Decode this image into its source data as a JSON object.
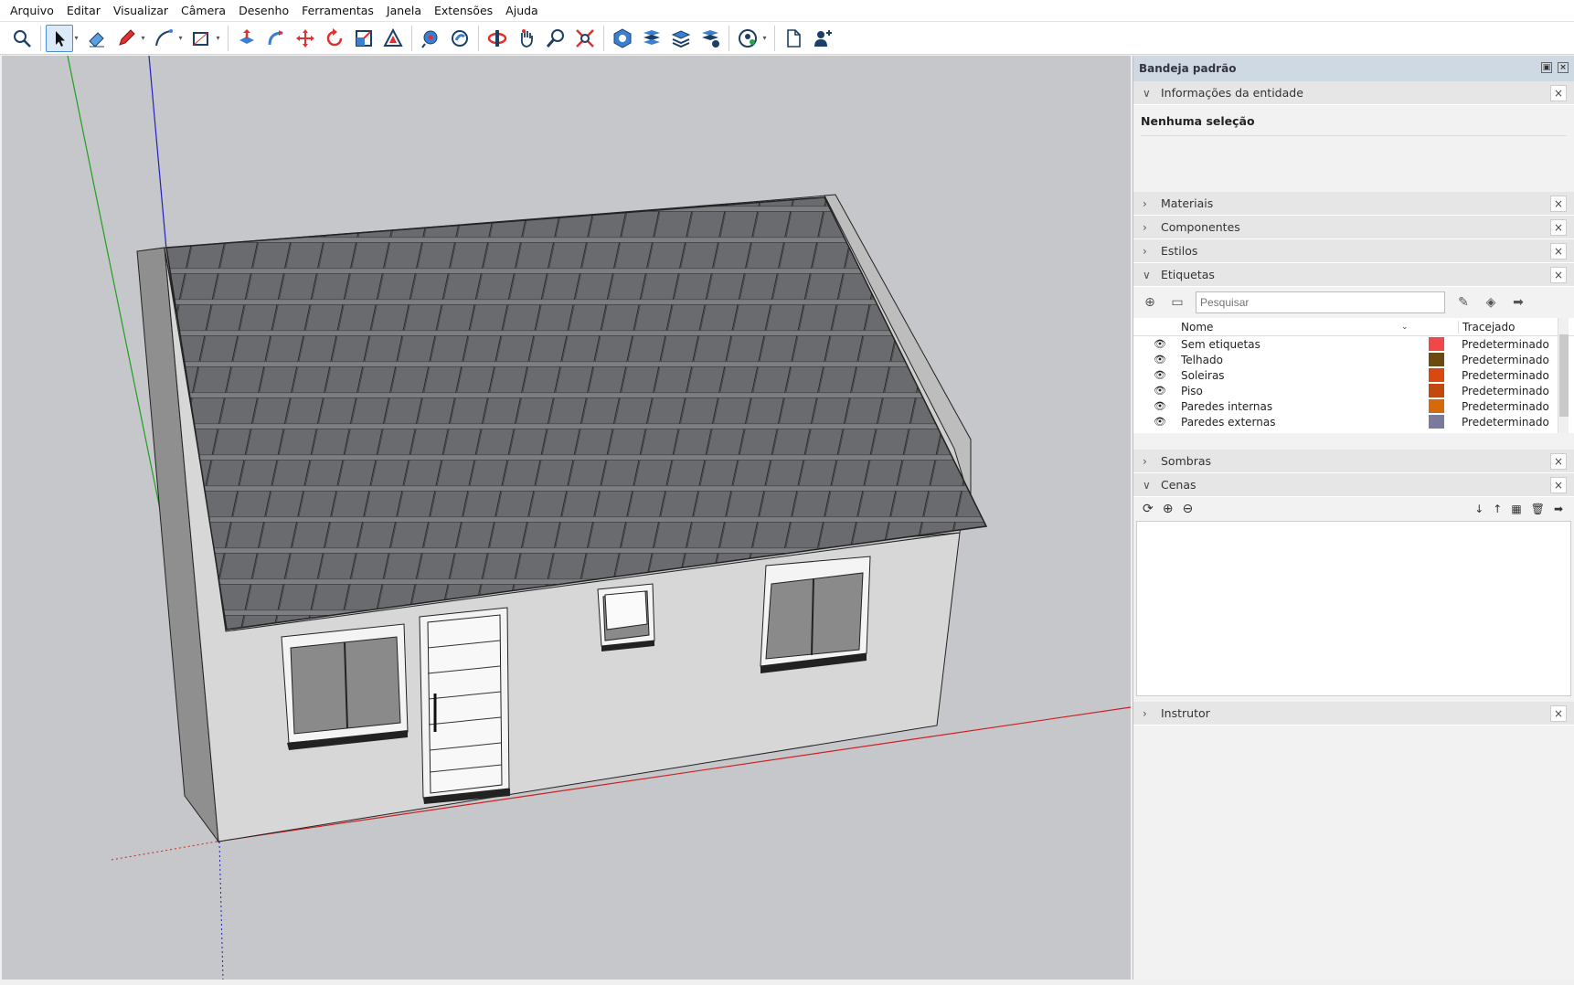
{
  "menu": [
    "Arquivo",
    "Editar",
    "Visualizar",
    "Câmera",
    "Desenho",
    "Ferramentas",
    "Janela",
    "Extensões",
    "Ajuda"
  ],
  "tray": {
    "title": "Bandeja padrão",
    "entity": {
      "header": "Informações da entidade",
      "status": "Nenhuma seleção"
    },
    "materials": "Materiais",
    "components": "Componentes",
    "styles": "Estilos",
    "tags": {
      "header": "Etiquetas",
      "search_placeholder": "Pesquisar",
      "col_name": "Nome",
      "col_dash": "Tracejado",
      "rows": [
        {
          "name": "Sem etiquetas",
          "color": "#f04848",
          "dash": "Predeterminado"
        },
        {
          "name": "Telhado",
          "color": "#6b4a12",
          "dash": "Predeterminado"
        },
        {
          "name": "Soleiras",
          "color": "#d9480f",
          "dash": "Predeterminado"
        },
        {
          "name": "Piso",
          "color": "#c2480f",
          "dash": "Predeterminado"
        },
        {
          "name": "Paredes internas",
          "color": "#d46a0c",
          "dash": "Predeterminado"
        },
        {
          "name": "Paredes externas",
          "color": "#7a7a9c",
          "dash": "Predeterminado"
        }
      ]
    },
    "shadows": "Sombras",
    "scenes": "Cenas",
    "instructor": "Instrutor"
  }
}
